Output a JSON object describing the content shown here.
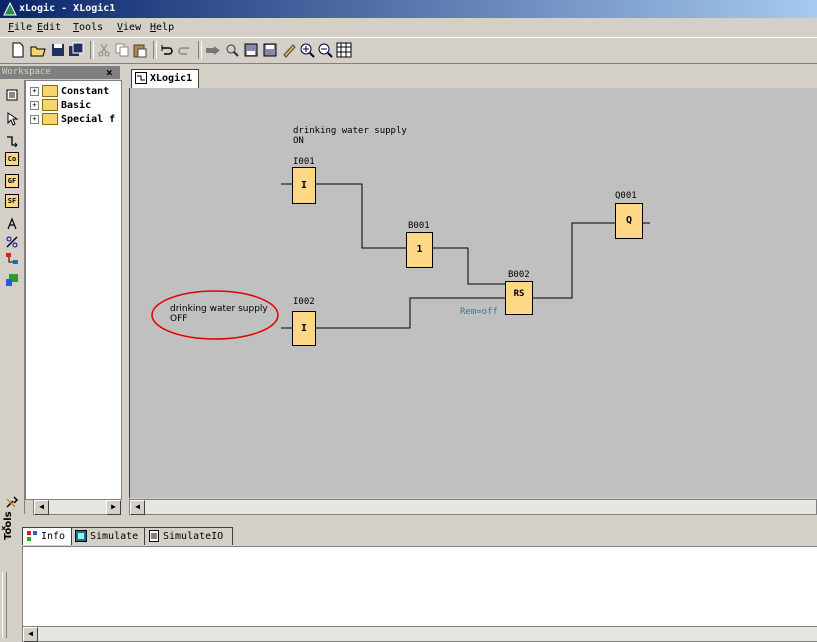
{
  "window": {
    "title": "xLogic - XLogic1"
  },
  "menu": [
    "File",
    "Edit",
    "Tools",
    "View",
    "Help"
  ],
  "toolbar": [
    "new-icon",
    "open-icon",
    "save-icon",
    "save-all-icon",
    "cut-icon",
    "copy-icon",
    "paste-icon",
    "undo-icon",
    "redo-icon",
    "simulate-icon",
    "transfer-icon",
    "upload-icon",
    "download-icon",
    "pen-icon",
    "zoom-in-icon",
    "zoom-out-icon",
    "grid-icon"
  ],
  "workspace": {
    "title": "Workspace",
    "close": "×",
    "tree": [
      {
        "expander": "+",
        "label": "Constant"
      },
      {
        "expander": "+",
        "label": "Basic"
      },
      {
        "expander": "+",
        "label": "Special f"
      }
    ]
  },
  "tools": {
    "label": "Tools",
    "items": [
      "blocks-icon",
      "select-icon",
      "connect-icon",
      "co-icon",
      "gf-icon",
      "sf-icon",
      "text-icon",
      "cut-line-icon",
      "network-icon",
      "simulate-icon"
    ],
    "co": "Co",
    "gf": "GF",
    "sf": "SF"
  },
  "document": {
    "tab": "XLogic1"
  },
  "diagram": {
    "label_on": [
      "drinking water supply",
      "ON"
    ],
    "label_off": [
      "drinking water supply",
      "OFF"
    ],
    "blocks": [
      {
        "id": "I001",
        "symbol": "I"
      },
      {
        "id": "I002",
        "symbol": "I"
      },
      {
        "id": "B001",
        "symbol": "1"
      },
      {
        "id": "B002",
        "symbol": "RS",
        "remark": "Rem=off"
      },
      {
        "id": "Q001",
        "symbol": "Q"
      }
    ]
  },
  "bottom_tabs": [
    {
      "label": "Info",
      "icon": "info-icon"
    },
    {
      "label": "Simulate",
      "icon": "simulate-icon"
    },
    {
      "label": "SimulateIO",
      "icon": "document-icon"
    }
  ],
  "colors": {
    "block_fill": "#ffd886",
    "canvas": "#c0c0c0",
    "annotation": "#e00000",
    "remark": "#3a7a8a"
  }
}
